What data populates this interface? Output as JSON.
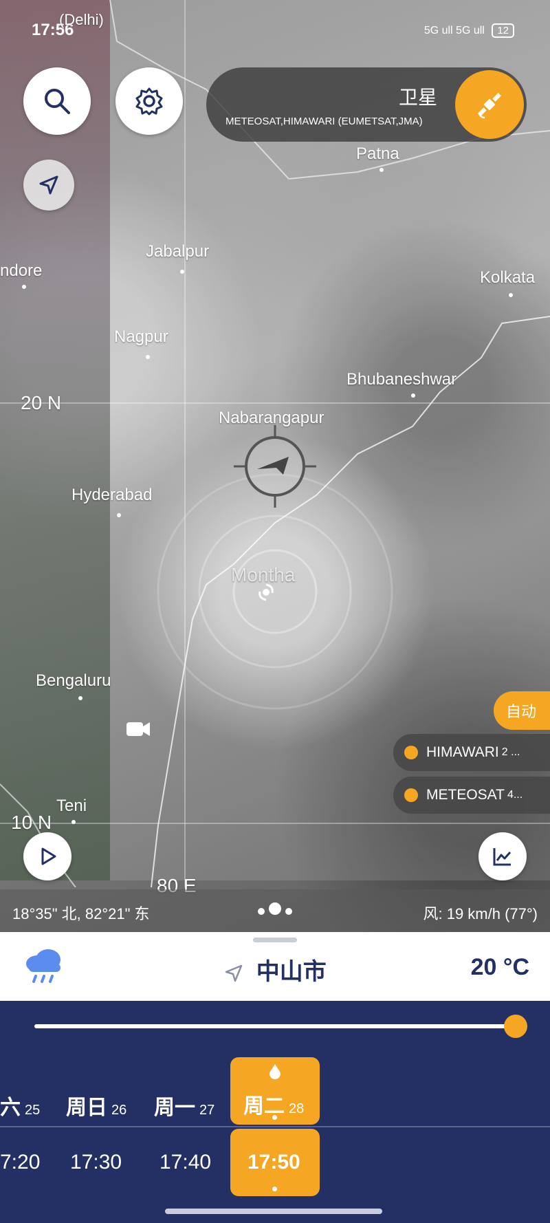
{
  "status_bar": {
    "time": "17:56",
    "network": "5G ull 5G ull",
    "battery": "12"
  },
  "top_controls": {
    "layer_title": "卫星",
    "layer_subtitle": "METEOSAT,HIMAWARI (EUMETSAT,JMA)"
  },
  "map_labels": {
    "delhi": "(Delhi)",
    "patna": "Patna",
    "jabalpur": "Jabalpur",
    "indore": "ndore",
    "kolkata": "Kolkata",
    "nagpur": "Nagpur",
    "bhubaneshwar": "Bhubaneshwar",
    "lat20": "20 N",
    "nabarangapur": "Nabarangapur",
    "hyderabad": "Hyderabad",
    "montha": "Montha",
    "bengaluru": "Bengaluru",
    "teni": "Teni",
    "lat10": "10 N",
    "lon80": "80 E"
  },
  "source_controls": {
    "auto_label": "自动",
    "himawari": "HIMAWARI",
    "himawari_extra": "2 ...",
    "meteosat": "METEOSAT",
    "meteosat_extra": "4..."
  },
  "coord_bar": {
    "coords": "18°35\" 北, 82°21\" 东",
    "wind": "风: 19 km/h (77°)"
  },
  "location_panel": {
    "city": "中山市",
    "temperature": "20 °C"
  },
  "timeline": {
    "progress": 1.0,
    "days": [
      {
        "name": "六",
        "num": "25"
      },
      {
        "name": "周日",
        "num": "26"
      },
      {
        "name": "周一",
        "num": "27"
      },
      {
        "name": "周二",
        "num": "28"
      }
    ],
    "times": [
      "7:20",
      "17:30",
      "17:40",
      "17:50"
    ],
    "selected_index": 3
  },
  "colors": {
    "accent": "#f5a623",
    "navy": "#243064"
  }
}
